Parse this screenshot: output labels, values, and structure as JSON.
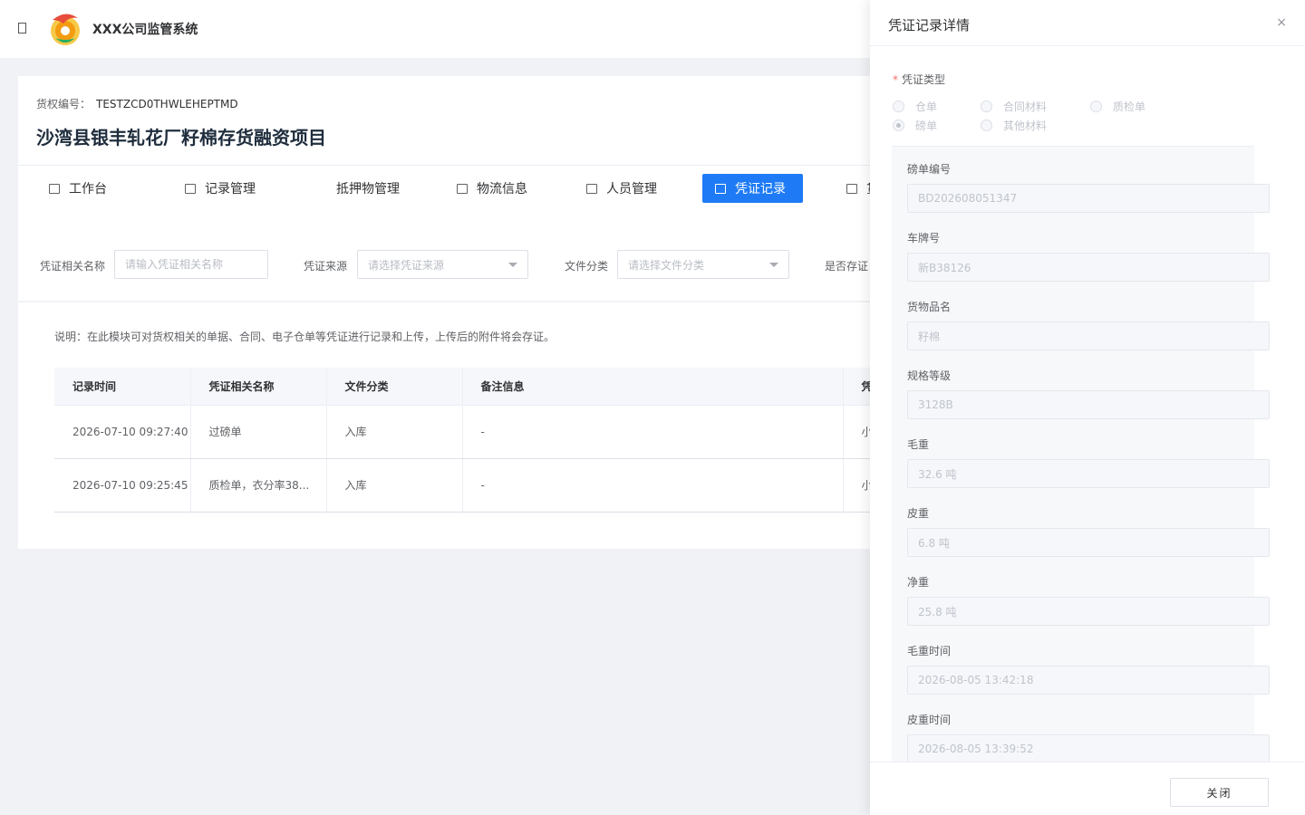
{
  "app": {
    "title": "XXX公司监管系统"
  },
  "project": {
    "code_label": "货权编号：",
    "code_value": "TESTZCD0THWLEHEPTMD",
    "title": "沙湾县银丰轧花厂籽棉存货融资项目"
  },
  "tabs": [
    {
      "label": "工作台",
      "icon": "monitor-icon",
      "active": false
    },
    {
      "label": "记录管理",
      "icon": "book-icon",
      "active": false
    },
    {
      "label": "抵押物管理",
      "icon": "",
      "active": false
    },
    {
      "label": "物流信息",
      "icon": "truck-icon",
      "active": false
    },
    {
      "label": "人员管理",
      "icon": "users-icon",
      "active": false
    },
    {
      "label": "凭证记录",
      "icon": "image-icon",
      "active": true
    },
    {
      "label": "货值",
      "icon": "bell-icon",
      "active": false
    }
  ],
  "filters": {
    "name_label": "凭证相关名称",
    "name_placeholder": "请输入凭证相关名称",
    "source_label": "凭证来源",
    "source_placeholder": "请选择凭证来源",
    "category_label": "文件分类",
    "category_placeholder": "请选择文件分类",
    "stored_label": "是否存证"
  },
  "note": "说明：在此模块可对货权相关的单据、合同、电子仓单等凭证进行记录和上传，上传后的附件将会存证。",
  "table": {
    "headers": [
      "记录时间",
      "凭证相关名称",
      "文件分类",
      "备注信息",
      "凭"
    ],
    "rows": [
      [
        "2026-07-10 09:27:40",
        "过磅单",
        "入库",
        "-",
        "小"
      ],
      [
        "2026-07-10 09:25:45",
        "质检单，衣分率38...",
        "入库",
        "-",
        "小"
      ]
    ]
  },
  "drawer": {
    "title": "凭证记录详情",
    "close_symbol": "×",
    "type_label": "凭证类型",
    "type_options": [
      "仓单",
      "合同材料",
      "质检单",
      "磅单",
      "其他材料"
    ],
    "type_selected": "磅单",
    "fields": [
      {
        "label": "磅单编号",
        "value": "BD202608051347"
      },
      {
        "label": "车牌号",
        "value": "新B38126"
      },
      {
        "label": "货物品名",
        "value": "籽棉"
      },
      {
        "label": "规格等级",
        "value": "3128B"
      },
      {
        "label": "毛重",
        "value": "32.6 吨"
      },
      {
        "label": "皮重",
        "value": "6.8 吨"
      },
      {
        "label": "净重",
        "value": "25.8 吨"
      },
      {
        "label": "毛重时间",
        "value": "2026-08-05 13:42:18"
      },
      {
        "label": "皮重时间",
        "value": "2026-08-05 13:39:52"
      }
    ],
    "close_button": "关闭"
  }
}
